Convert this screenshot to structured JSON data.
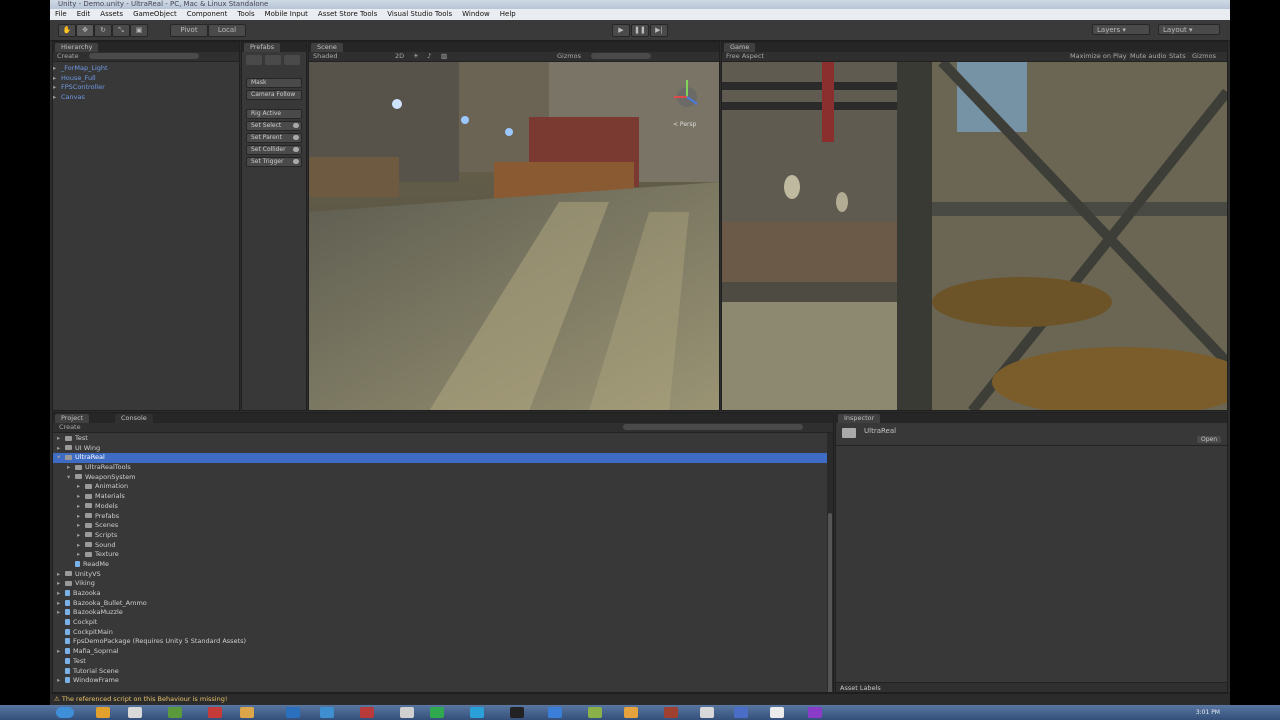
{
  "window": {
    "title": "Unity - Demo.unity - UltraReal - PC, Mac & Linux Standalone"
  },
  "menu": [
    "File",
    "Edit",
    "Assets",
    "GameObject",
    "Component",
    "Tools",
    "Mobile Input",
    "Asset Store Tools",
    "Visual Studio Tools",
    "Window",
    "Help"
  ],
  "toolbar": {
    "pivot": "Pivot",
    "local": "Local",
    "layers": "Layers",
    "layout": "Layout"
  },
  "hierarchy": {
    "tab": "Hierarchy",
    "create": "Create",
    "items": [
      "_ForMap_Light",
      "House_Full",
      "FPSController",
      "Canvas"
    ]
  },
  "prefabs_panel": {
    "tab": "Prefabs",
    "buttons": [
      "Mask",
      "Camera Follow",
      "Rig Active",
      "Set Select",
      "Set Parent",
      "Set Collider",
      "Set Trigger"
    ]
  },
  "scene": {
    "tab": "Scene",
    "shading": "Shaded",
    "mode": "2D",
    "gizmos": "Gizmos",
    "search": "All",
    "persp": "< Persp"
  },
  "game": {
    "tab": "Game",
    "aspect": "Free Aspect",
    "opts": [
      "Maximize on Play",
      "Mute audio",
      "Stats",
      "Gizmos"
    ]
  },
  "project": {
    "tab": "Project",
    "console_tab": "Console",
    "create": "Create",
    "items": [
      {
        "label": "Test",
        "depth": 0,
        "type": "folder",
        "arrow": "▸"
      },
      {
        "label": "UI Wing",
        "depth": 0,
        "type": "folder",
        "arrow": "▸"
      },
      {
        "label": "UltraReal",
        "depth": 0,
        "type": "folder",
        "arrow": "▾",
        "selected": true
      },
      {
        "label": "UltraRealTools",
        "depth": 1,
        "type": "folder",
        "arrow": "▸"
      },
      {
        "label": "WeaponSystem",
        "depth": 1,
        "type": "folder",
        "arrow": "▾"
      },
      {
        "label": "Animation",
        "depth": 2,
        "type": "folder",
        "arrow": "▸"
      },
      {
        "label": "Materials",
        "depth": 2,
        "type": "folder",
        "arrow": "▸"
      },
      {
        "label": "Models",
        "depth": 2,
        "type": "folder",
        "arrow": "▸"
      },
      {
        "label": "Prefabs",
        "depth": 2,
        "type": "folder",
        "arrow": "▸"
      },
      {
        "label": "Scenes",
        "depth": 2,
        "type": "folder",
        "arrow": "▸"
      },
      {
        "label": "Scripts",
        "depth": 2,
        "type": "folder",
        "arrow": "▸"
      },
      {
        "label": "Sound",
        "depth": 2,
        "type": "folder",
        "arrow": "▸"
      },
      {
        "label": "Texture",
        "depth": 2,
        "type": "folder",
        "arrow": "▸"
      },
      {
        "label": "ReadMe",
        "depth": 1,
        "type": "file",
        "arrow": ""
      },
      {
        "label": "UnityVS",
        "depth": 0,
        "type": "folder",
        "arrow": "▸"
      },
      {
        "label": "Viking",
        "depth": 0,
        "type": "folder",
        "arrow": "▸"
      },
      {
        "label": "Bazooka",
        "depth": 0,
        "type": "file",
        "arrow": "▸"
      },
      {
        "label": "Bazooka_Bullet_Ammo",
        "depth": 0,
        "type": "file",
        "arrow": "▸"
      },
      {
        "label": "BazookaMuzzle",
        "depth": 0,
        "type": "file",
        "arrow": "▸"
      },
      {
        "label": "Cockpit",
        "depth": 0,
        "type": "file",
        "arrow": ""
      },
      {
        "label": "CockpitMain",
        "depth": 0,
        "type": "file",
        "arrow": ""
      },
      {
        "label": "FpsDemoPackage (Requires Unity 5 Standard Assets)",
        "depth": 0,
        "type": "file",
        "arrow": ""
      },
      {
        "label": "Mafia_Soprnal",
        "depth": 0,
        "type": "file",
        "arrow": "▸"
      },
      {
        "label": "Test",
        "depth": 0,
        "type": "file",
        "arrow": ""
      },
      {
        "label": "Tutorial Scene",
        "depth": 0,
        "type": "file",
        "arrow": ""
      },
      {
        "label": "WindowFrame",
        "depth": 0,
        "type": "file",
        "arrow": "▸"
      }
    ]
  },
  "inspector": {
    "tab": "Inspector",
    "object": "UltraReal",
    "open": "Open",
    "asset_labels": "Asset Labels"
  },
  "status": {
    "message": "The referenced script on this Behaviour is missing!"
  },
  "clock": "3:01 PM",
  "colors": {
    "selection": "#3e6cc4",
    "panel": "#383838",
    "tabbar": "#262626"
  }
}
